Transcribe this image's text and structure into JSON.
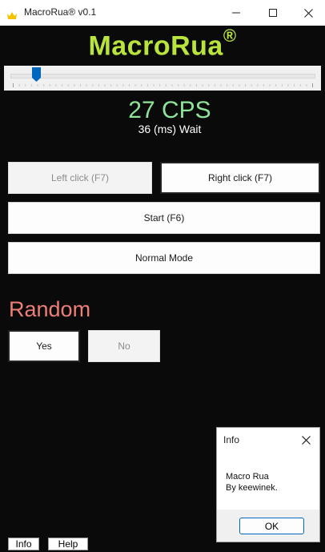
{
  "window": {
    "title": "MacroRua® v0.1",
    "icon": "crown-icon",
    "controls": {
      "minimize_icon": "minimize-icon",
      "maximize_icon": "maximize-icon",
      "close_icon": "close-icon"
    }
  },
  "header": {
    "brand": "MacroRua",
    "brand_mark": "®",
    "brand_color": "#b9e33d"
  },
  "speed_slider": {
    "value_fraction": 0.08
  },
  "stats": {
    "cps": "27 CPS",
    "wait": "36 (ms) Wait",
    "cps_color": "#8ee59a"
  },
  "buttons": {
    "left_click": "Left click (F7)",
    "right_click": "Right click (F7)",
    "start": "Start (F6)",
    "mode": "Normal Mode"
  },
  "random": {
    "label": "Random",
    "label_color": "#ee7f75",
    "yes": "Yes",
    "no": "No"
  },
  "footer": {
    "info": "Info",
    "help": "Help"
  },
  "info_dialog": {
    "title": "Info",
    "line1": "Macro Rua",
    "line2": "By keewinek.",
    "ok": "OK"
  }
}
